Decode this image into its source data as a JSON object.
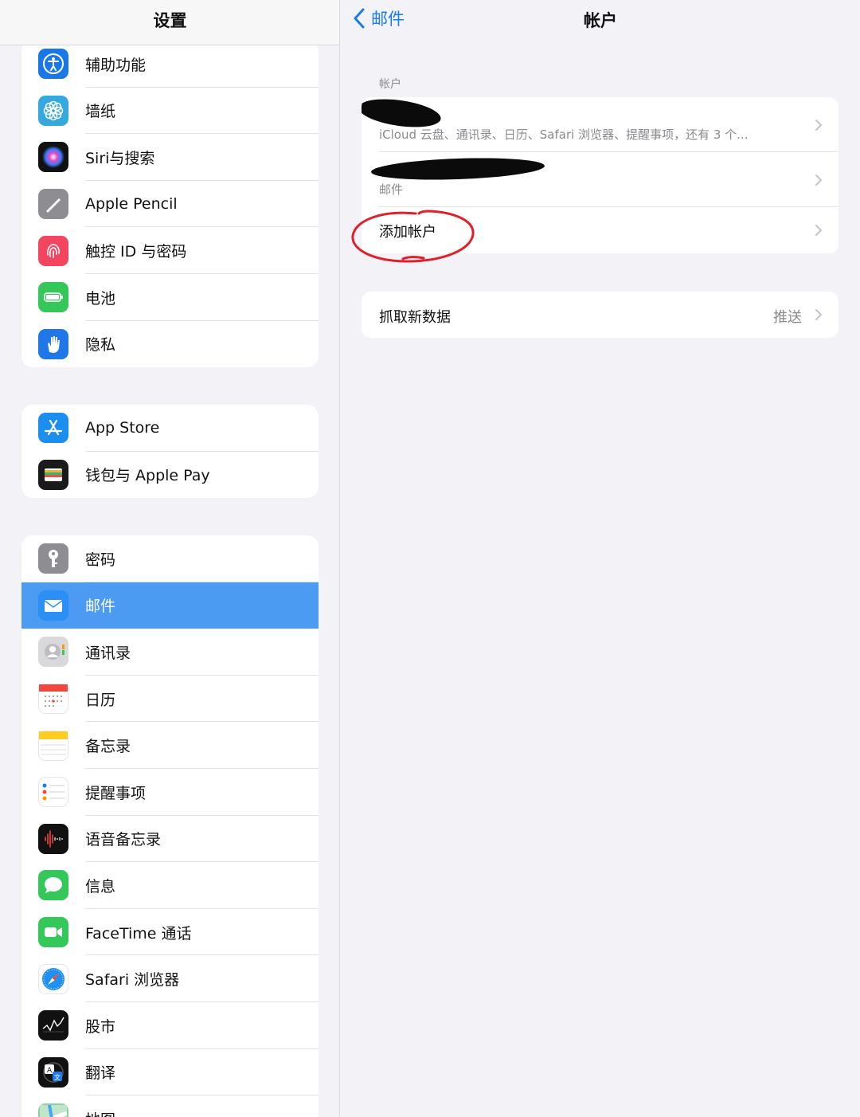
{
  "sidebar": {
    "title": "设置",
    "group1": [
      {
        "label": "辅助功能",
        "icon": "accessibility-icon"
      },
      {
        "label": "墙纸",
        "icon": "wallpaper-icon"
      },
      {
        "label": "Siri与搜索",
        "icon": "siri-icon"
      },
      {
        "label": "Apple Pencil",
        "icon": "pencil-icon"
      },
      {
        "label": "触控 ID 与密码",
        "icon": "fingerprint-icon"
      },
      {
        "label": "电池",
        "icon": "battery-icon"
      },
      {
        "label": "隐私",
        "icon": "privacy-hand-icon"
      }
    ],
    "group2": [
      {
        "label": "App Store",
        "icon": "app-store-icon"
      },
      {
        "label": "钱包与 Apple Pay",
        "icon": "wallet-icon"
      }
    ],
    "group3": [
      {
        "label": "密码",
        "icon": "key-icon"
      },
      {
        "label": "邮件",
        "icon": "mail-icon",
        "selected": true
      },
      {
        "label": "通讯录",
        "icon": "contacts-icon"
      },
      {
        "label": "日历",
        "icon": "calendar-icon"
      },
      {
        "label": "备忘录",
        "icon": "notes-icon"
      },
      {
        "label": "提醒事项",
        "icon": "reminders-icon"
      },
      {
        "label": "语音备忘录",
        "icon": "voice-memos-icon"
      },
      {
        "label": "信息",
        "icon": "messages-icon"
      },
      {
        "label": "FaceTime 通话",
        "icon": "facetime-icon"
      },
      {
        "label": "Safari 浏览器",
        "icon": "safari-icon"
      },
      {
        "label": "股市",
        "icon": "stocks-icon"
      },
      {
        "label": "翻译",
        "icon": "translate-icon"
      },
      {
        "label": "地图",
        "icon": "maps-icon"
      }
    ]
  },
  "detail": {
    "back_label": "邮件",
    "title": "帐户",
    "section_header": "帐户",
    "accounts": [
      {
        "subtitle": "iCloud 云盘、通讯录、日历、Safari 浏览器、提醒事项，还有 3 个..."
      },
      {
        "subtitle": "邮件"
      }
    ],
    "add_account_label": "添加帐户",
    "fetch_label": "抓取新数据",
    "fetch_value": "推送"
  },
  "colors": {
    "accent": "#1a7bea",
    "selected_row": "#4c9bf2",
    "annotation": "#e0202a"
  }
}
